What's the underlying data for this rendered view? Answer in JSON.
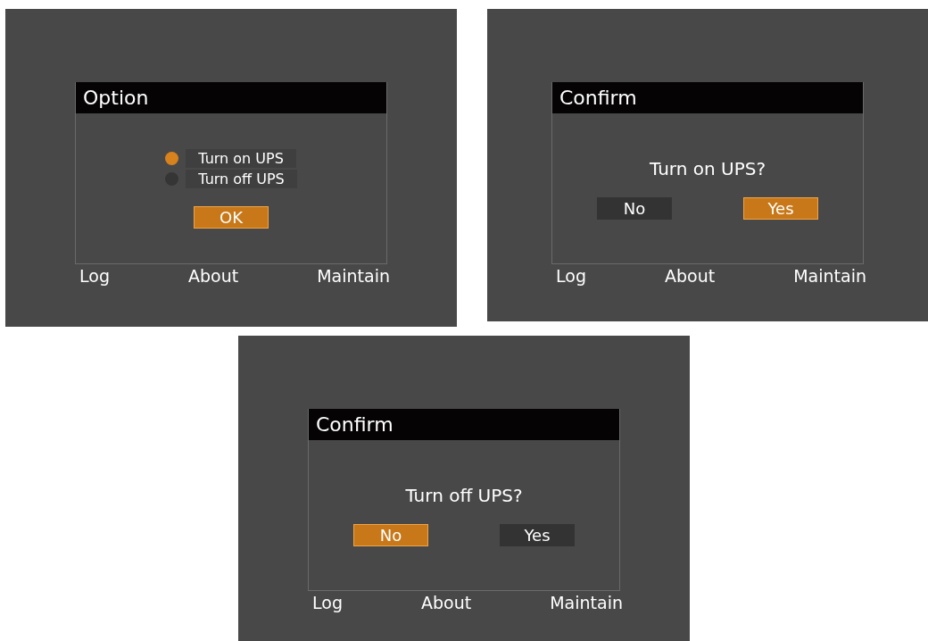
{
  "screens": [
    {
      "kind": "option",
      "title": "Option",
      "options": [
        {
          "label": "Turn on UPS",
          "selected": true
        },
        {
          "label": "Turn off UPS",
          "selected": false
        }
      ],
      "buttons": [
        {
          "label": "OK",
          "selected": true
        }
      ],
      "menu": [
        "Log",
        "About",
        "Maintain"
      ]
    },
    {
      "kind": "confirm",
      "title": "Confirm",
      "message": "Turn on UPS?",
      "buttons": [
        {
          "label": "No",
          "selected": false
        },
        {
          "label": "Yes",
          "selected": true
        }
      ],
      "menu": [
        "Log",
        "About",
        "Maintain"
      ]
    },
    {
      "kind": "confirm",
      "title": "Confirm",
      "message": "Turn off UPS?",
      "buttons": [
        {
          "label": "No",
          "selected": true
        },
        {
          "label": "Yes",
          "selected": false
        }
      ],
      "menu": [
        "Log",
        "About",
        "Maintain"
      ]
    }
  ]
}
